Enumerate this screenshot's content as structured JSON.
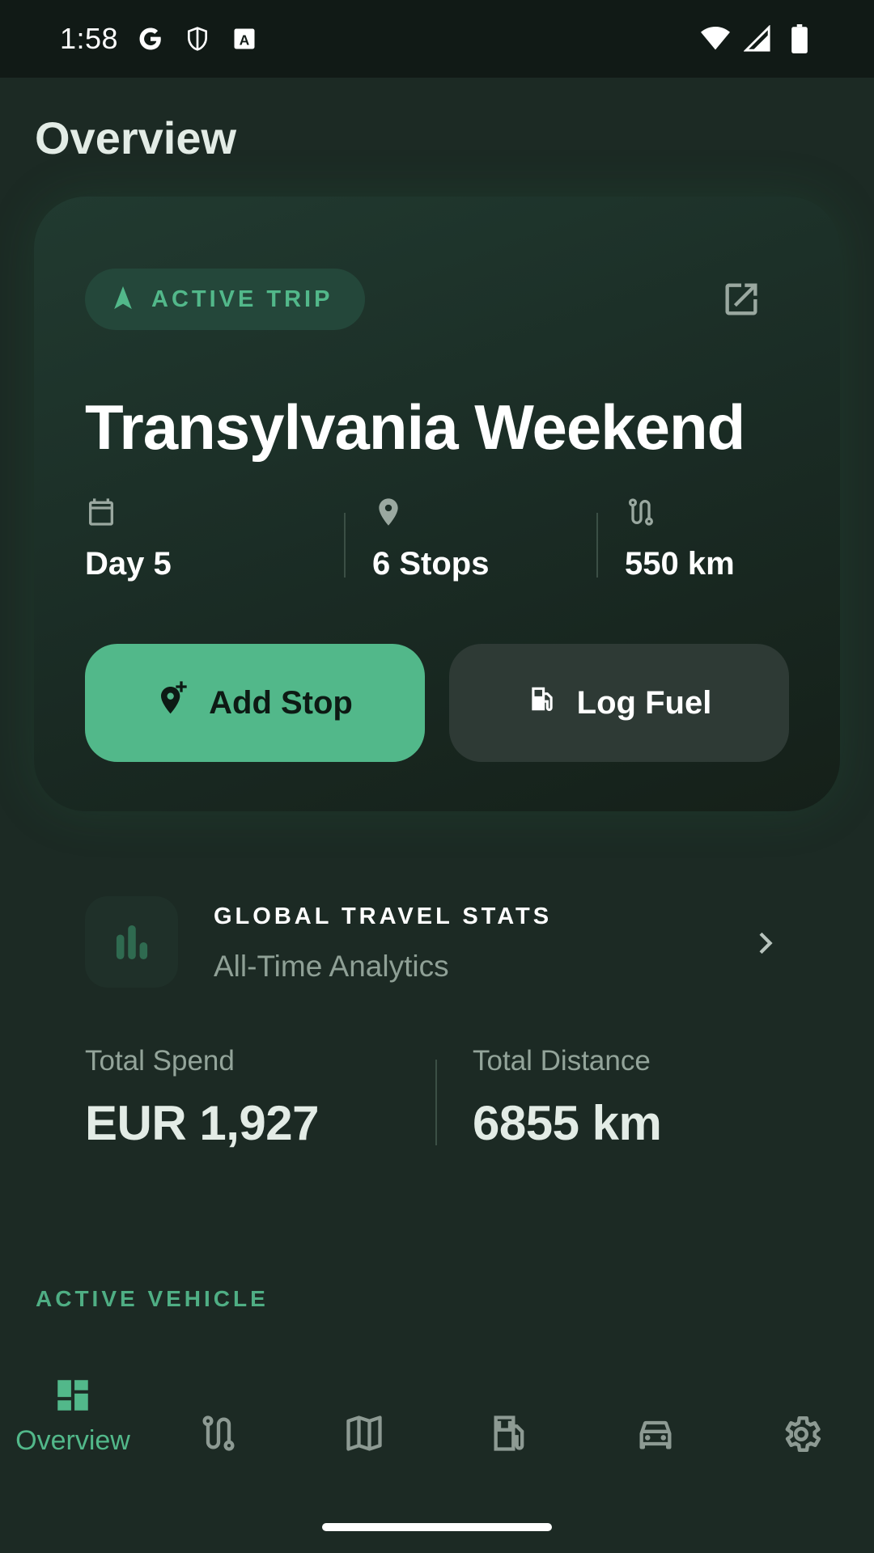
{
  "status_bar": {
    "time": "1:58",
    "icons_left": [
      "google-icon",
      "shield-icon",
      "font-a-icon"
    ],
    "icons_right": [
      "wifi-icon",
      "cell-signal-icon",
      "battery-icon"
    ]
  },
  "page": {
    "title": "Overview"
  },
  "active_trip": {
    "badge_label": "ACTIVE TRIP",
    "title": "Transylvania Weekend",
    "stats": [
      {
        "icon": "calendar-icon",
        "value": "Day 5"
      },
      {
        "icon": "location-pin-icon",
        "value": "6 Stops"
      },
      {
        "icon": "route-icon",
        "value": "550 km"
      }
    ],
    "add_stop_label": "Add Stop",
    "log_fuel_label": "Log Fuel"
  },
  "global_stats": {
    "title": "GLOBAL TRAVEL STATS",
    "subtitle": "All-Time Analytics",
    "metrics": [
      {
        "label": "Total Spend",
        "value": "EUR 1,927"
      },
      {
        "label": "Total Distance",
        "value": "6855 km"
      }
    ]
  },
  "section": {
    "active_vehicle_label": "ACTIVE VEHICLE"
  },
  "bottom_nav": {
    "items": [
      {
        "icon": "dashboard-icon",
        "label": "Overview",
        "active": true
      },
      {
        "icon": "route-icon",
        "label": ""
      },
      {
        "icon": "map-icon",
        "label": ""
      },
      {
        "icon": "fuel-pump-icon",
        "label": ""
      },
      {
        "icon": "car-icon",
        "label": ""
      },
      {
        "icon": "gear-icon",
        "label": ""
      }
    ]
  },
  "colors": {
    "accent": "#52b88a",
    "background": "#1c2a24",
    "card": "#1f342b",
    "secondary_button": "#2e3a35"
  }
}
